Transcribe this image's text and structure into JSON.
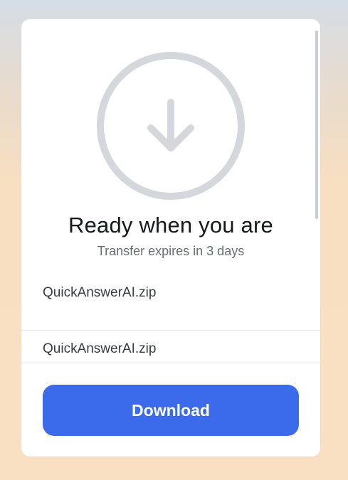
{
  "transfer": {
    "title": "Ready when you are",
    "subtitle": "Transfer expires in 3 days"
  },
  "files": [
    {
      "name": "QuickAnswerAI.zip"
    },
    {
      "name": "QuickAnswerAI.zip"
    }
  ],
  "footer": {
    "download_label": "Download"
  },
  "icons": {
    "hero": "download-circle-icon",
    "row": "download-icon"
  },
  "colors": {
    "accent": "#3b6bea",
    "hero_icon": "#d4d7db",
    "text_primary": "#17181a",
    "text_secondary": "#6a6d72"
  }
}
